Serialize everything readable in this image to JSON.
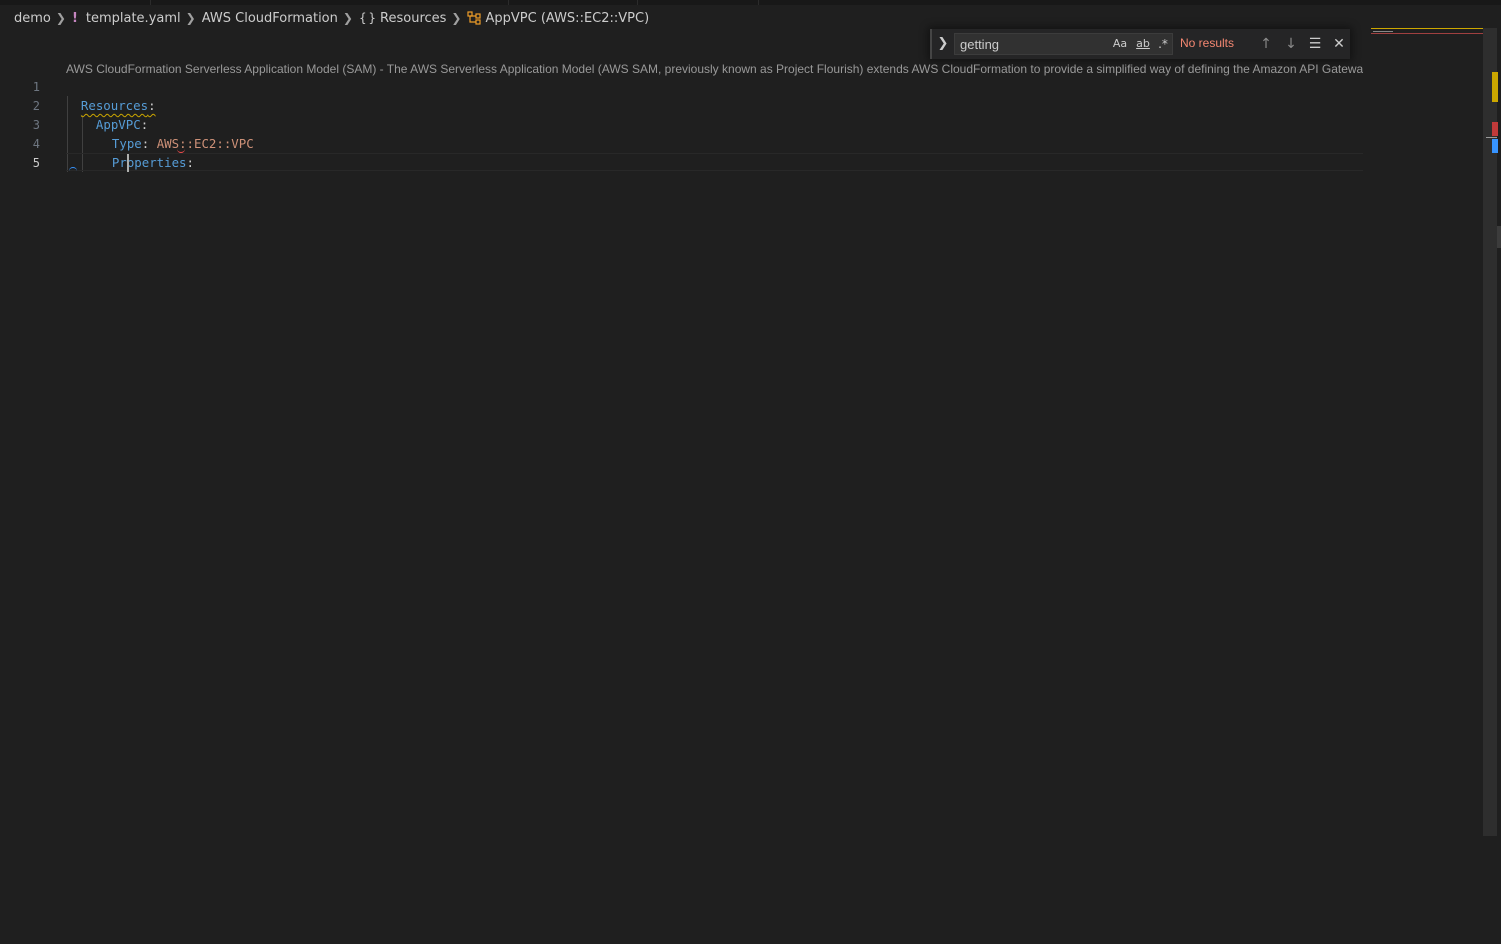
{
  "breadcrumb": {
    "items": [
      "demo",
      "template.yaml",
      "AWS CloudFormation",
      "Resources",
      "AppVPC (AWS::EC2::VPC)"
    ],
    "yaml_icon": "!",
    "braces_icon": "{ }"
  },
  "find": {
    "query": "getting",
    "case_label": "Aa",
    "word_label": "ab",
    "regex_label": ".*",
    "status": "No results",
    "status_color": "#f48771"
  },
  "codelens": "AWS CloudFormation Serverless Application Model (SAM) - The AWS Serverless Application Model (AWS SAM, previously known as Project Flourish) extends AWS CloudFormation to provide a simplified way of defining the Amazon API Gateway A",
  "editor": {
    "line_numbers": [
      "1",
      "2",
      "3",
      "4",
      "5"
    ],
    "lines": {
      "l1_key": "Resources",
      "l2_key": "AppVPC",
      "l3_key": "Type",
      "l3_value": "AWS::EC2::VPC",
      "l4_key": "Properties",
      "colon": ":"
    }
  },
  "colors": {
    "background": "#1f1f1f",
    "key": "#569cd6",
    "value": "#ce9178",
    "warning": "#cca700",
    "error": "#f14c4c"
  }
}
